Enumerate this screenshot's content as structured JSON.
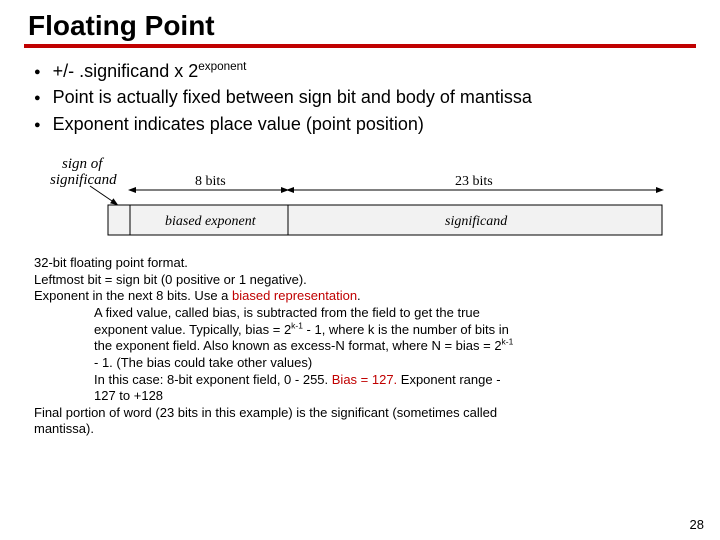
{
  "title": "Floating Point",
  "bullets": {
    "b1_pre": "+/- .significand x 2",
    "b1_sup": "exponent",
    "b2": "Point is actually fixed between sign bit and body of mantissa",
    "b3": "Exponent indicates place value (point position)"
  },
  "diagram": {
    "sign_label_1": "sign of",
    "sign_label_2": "significand",
    "exp_width": "8 bits",
    "sig_width": "23 bits",
    "exp_field": "biased exponent",
    "sig_field": "significand"
  },
  "notes": {
    "n1": "32-bit floating point format.",
    "n2": "Leftmost bit = sign bit (0 positive or 1 negative).",
    "n3_a": "Exponent in the next 8 bits. Use a ",
    "n3_red": "biased representation",
    "n3_b": ".",
    "n4": "A fixed value, called bias, is subtracted from the field to get the true",
    "n5_a": "exponent value.  Typically, bias = 2",
    "n5_sup": "k-1",
    "n5_b": " - 1, where k is the number of bits in",
    "n6_a": "the exponent field. Also known as excess-N format, where N = bias = 2",
    "n6_sup": "k-1",
    "n7": "- 1. (The bias could take other values)",
    "n8_a": "In this case: 8-bit exponent field, 0 - 255. ",
    "n8_red": "Bias = 127.",
    "n8_b": " Exponent range -",
    "n9": "127 to +128",
    "n10": "Final portion of word (23 bits in this example) is the significant (sometimes called",
    "n11": "mantissa)."
  },
  "page": "28"
}
